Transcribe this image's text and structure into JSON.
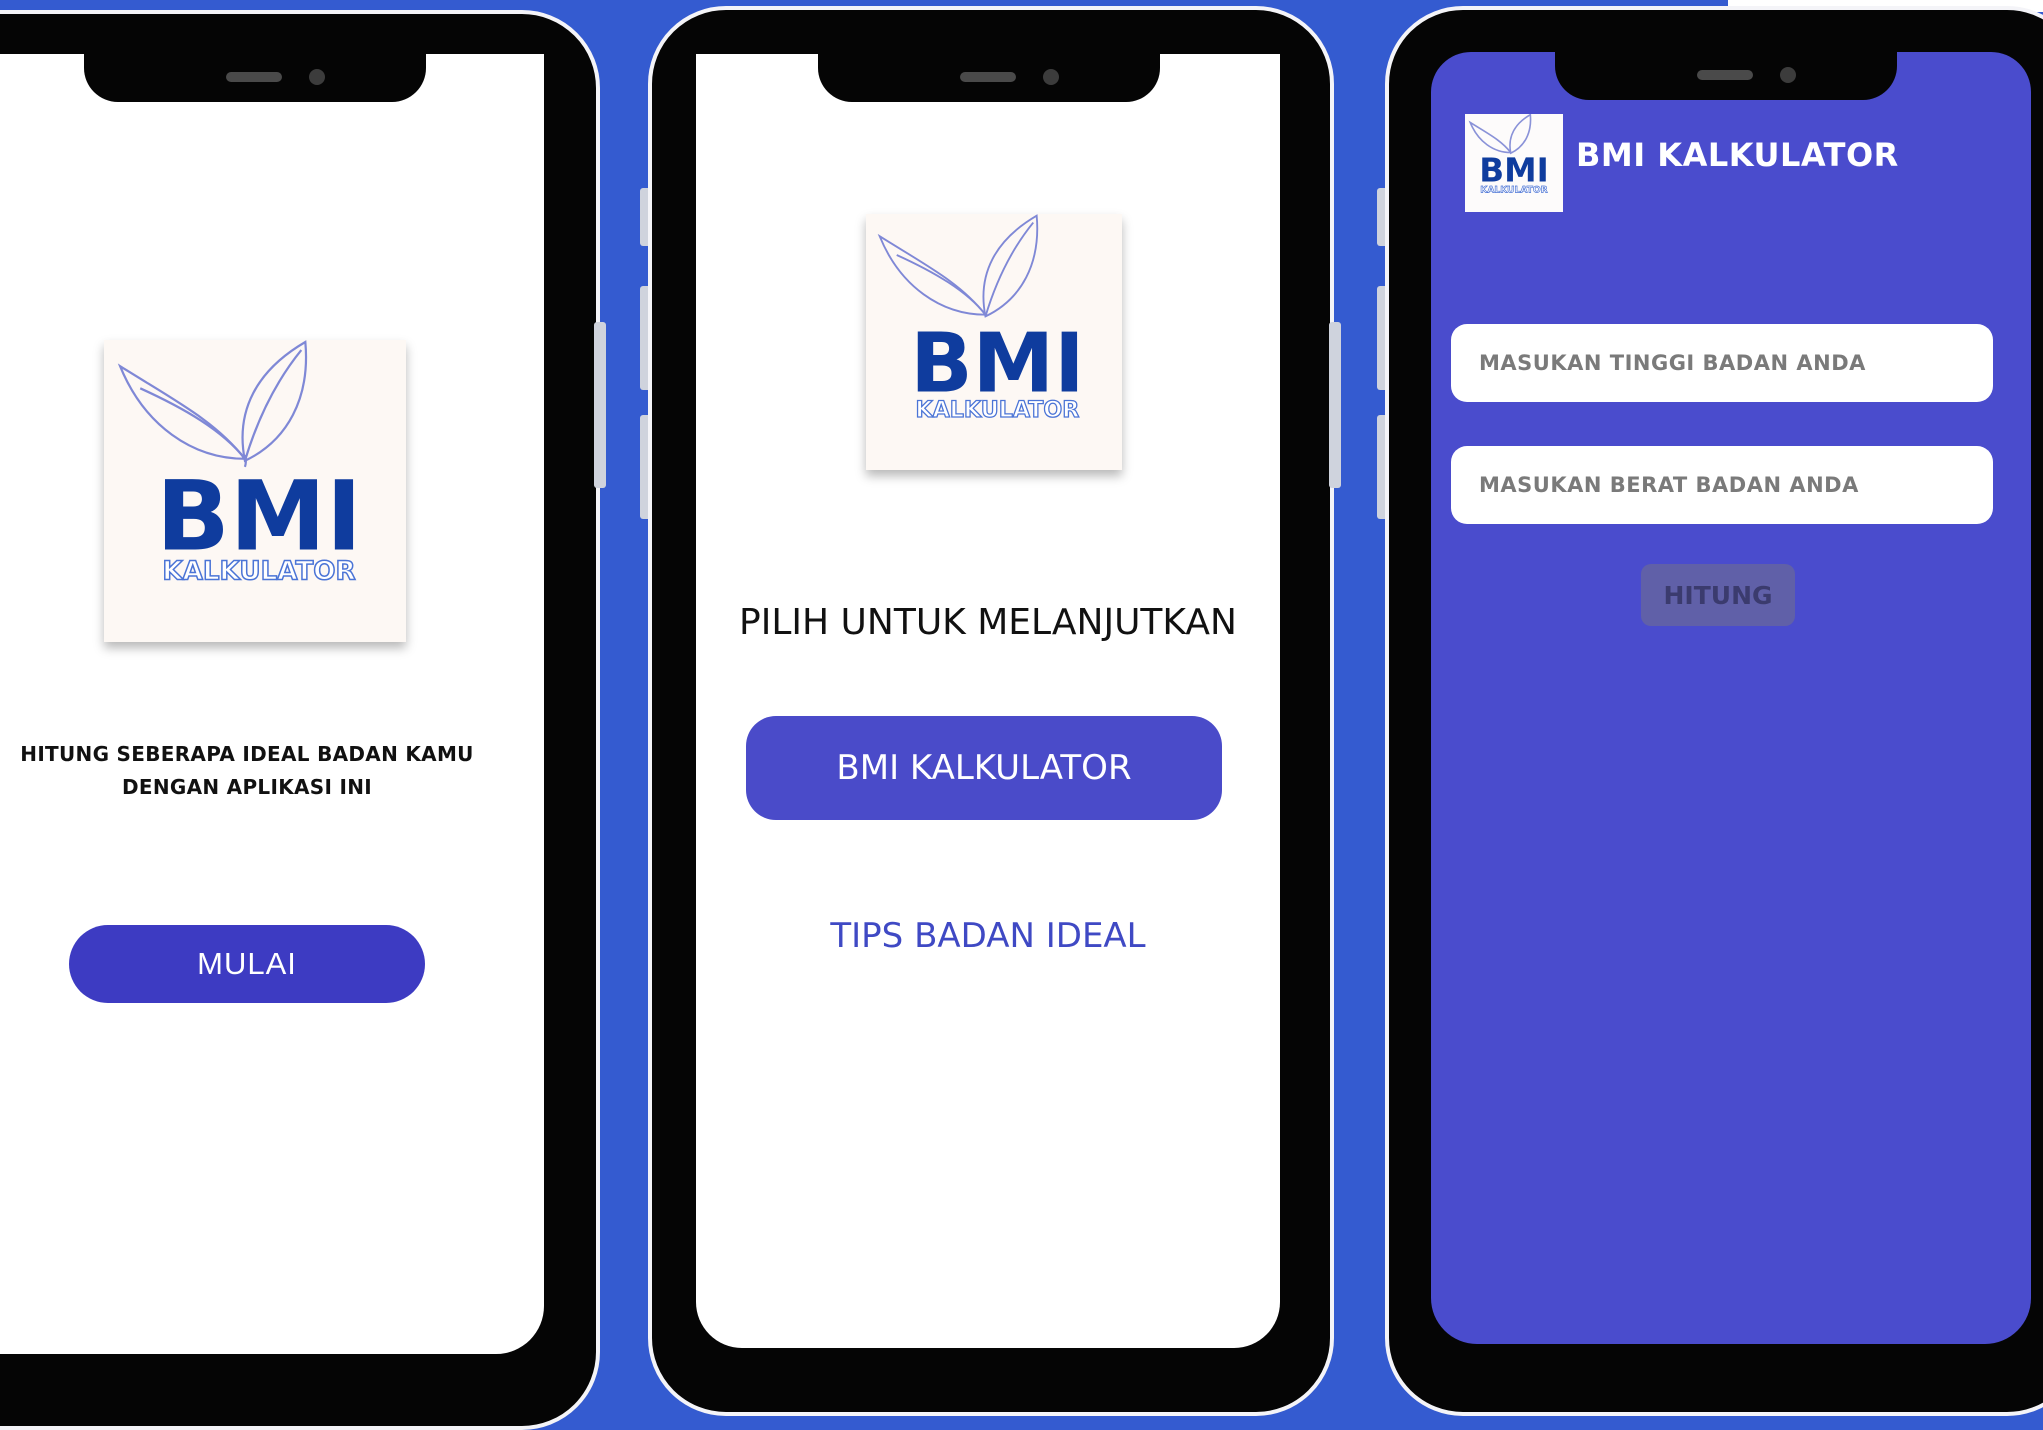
{
  "colors": {
    "background": "#345bd0",
    "primary": "#4a4bc9",
    "primary_dark": "#3d3bc2",
    "screen_white": "#ffffff",
    "link": "#3f49c4",
    "calc_bg": "#4a4ccd",
    "hitung_btn": "#6060a8"
  },
  "logo": {
    "title": "BMI",
    "subtitle": "KALKULATOR"
  },
  "screen1": {
    "tagline_line1": "HITUNG SEBERAPA IDEAL BADAN KAMU",
    "tagline_line2": "DENGAN APLIKASI INI",
    "start_button": "MULAI"
  },
  "screen2": {
    "prompt": "PILIH UNTUK MELANJUTKAN",
    "calculator_button": "BMI KALKULATOR",
    "tips_link": "TIPS BADAN IDEAL"
  },
  "screen3": {
    "app_title": "BMI KALKULATOR",
    "height_placeholder": "MASUKAN TINGGI BADAN ANDA",
    "weight_placeholder": "MASUKAN BERAT BADAN ANDA",
    "calculate_button": "HITUNG"
  },
  "icons": {
    "leaf": "leaf-icon"
  }
}
